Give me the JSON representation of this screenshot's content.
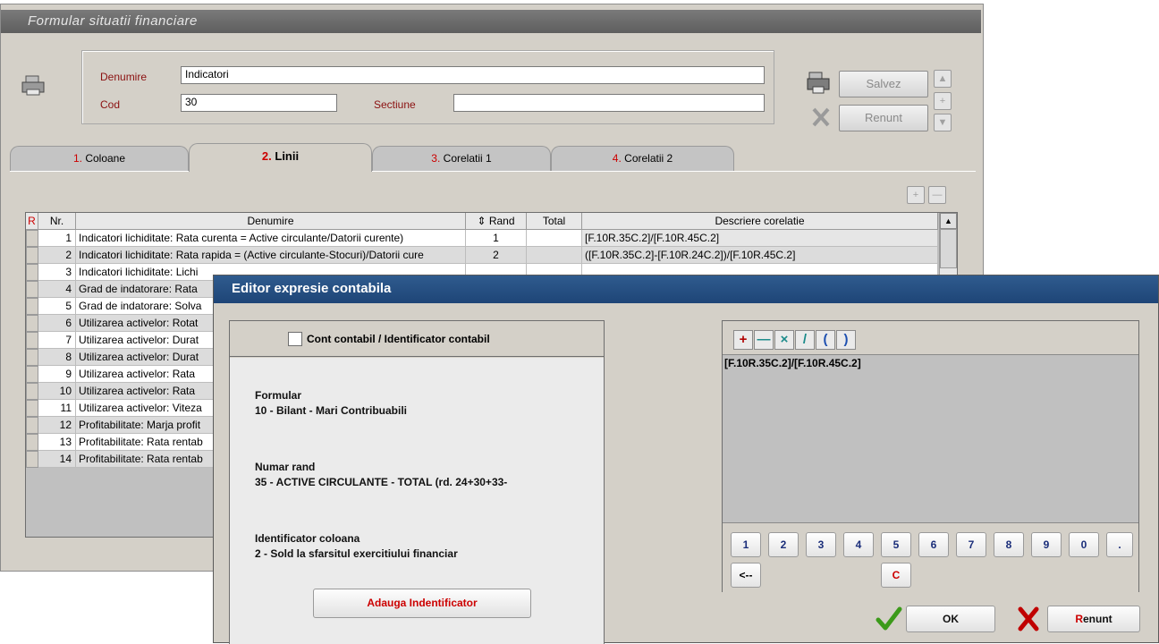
{
  "form": {
    "title": "Formular situatii financiare",
    "denumire_label": "Denumire",
    "denumire_value": "Indicatori",
    "cod_label": "Cod",
    "cod_value": "30",
    "sectiune_label": "Sectiune",
    "sectiune_value": "",
    "save_label": "Salvez",
    "cancel_label": "Renunt",
    "tabs": [
      {
        "num": "1.",
        "label": "Coloane"
      },
      {
        "num": "2.",
        "label": "Linii"
      },
      {
        "num": "3.",
        "label": "Corelatii 1"
      },
      {
        "num": "4.",
        "label": "Corelatii 2"
      }
    ],
    "grid": {
      "headers": {
        "r": "R",
        "nr": "Nr.",
        "denumire": "Denumire",
        "rand": "⇕ Rand",
        "total": "Total",
        "descriere": "Descriere corelatie"
      },
      "rows": [
        {
          "nr": "1",
          "den": "Indicatori lichiditate: Rata curenta = Active circulante/Datorii curente)",
          "rand": "1",
          "total": "",
          "desc": "[F.10R.35C.2]/[F.10R.45C.2]"
        },
        {
          "nr": "2",
          "den": "Indicatori lichiditate: Rata rapida = (Active circulante-Stocuri)/Datorii cure",
          "rand": "2",
          "total": "",
          "desc": "([F.10R.35C.2]-[F.10R.24C.2])/[F.10R.45C.2]"
        },
        {
          "nr": "3",
          "den": "Indicatori lichiditate: Lichi",
          "rand": "",
          "total": "",
          "desc": ""
        },
        {
          "nr": "4",
          "den": "Grad de indatorare: Rata",
          "rand": "",
          "total": "",
          "desc": ""
        },
        {
          "nr": "5",
          "den": "Grad de indatorare: Solva",
          "rand": "",
          "total": "",
          "desc": ""
        },
        {
          "nr": "6",
          "den": "Utilizarea activelor: Rotat",
          "rand": "",
          "total": "",
          "desc": ""
        },
        {
          "nr": "7",
          "den": "Utilizarea activelor: Durat",
          "rand": "",
          "total": "",
          "desc": ""
        },
        {
          "nr": "8",
          "den": "Utilizarea activelor: Durat",
          "rand": "",
          "total": "",
          "desc": ""
        },
        {
          "nr": "9",
          "den": "Utilizarea activelor: Rata",
          "rand": "",
          "total": "",
          "desc": ""
        },
        {
          "nr": "10",
          "den": "Utilizarea activelor: Rata",
          "rand": "",
          "total": "",
          "desc": ""
        },
        {
          "nr": "11",
          "den": "Utilizarea activelor: Viteza",
          "rand": "",
          "total": "",
          "desc": ""
        },
        {
          "nr": "12",
          "den": "Profitabilitate: Marja profit",
          "rand": "",
          "total": "",
          "desc": ""
        },
        {
          "nr": "13",
          "den": "Profitabilitate: Rata rentab",
          "rand": "",
          "total": "",
          "desc": ""
        },
        {
          "nr": "14",
          "den": "Profitabilitate: Rata rentab",
          "rand": "",
          "total": "",
          "desc": ""
        }
      ]
    }
  },
  "editor": {
    "title": "Editor expresie contabila",
    "checkbox_label": "Cont contabil / Identificator contabil",
    "formular_label": "Formular",
    "formular_value": "10 - Bilant - Mari Contribuabili",
    "numar_rand_label": "Numar rand",
    "numar_rand_value": "35 - ACTIVE CIRCULANTE - TOTAL (rd. 24+30+33-",
    "identificator_label": "Identificator coloana",
    "identificator_value": "2 - Sold la sfarsitul exercitiului financiar",
    "add_button": "Adauga Indentificator",
    "expression": "[F.10R.35C.2]/[F.10R.45C.2]",
    "operators": [
      "+",
      "—",
      "×",
      "/",
      "(",
      ")"
    ],
    "keys": [
      "1",
      "2",
      "3",
      "4",
      "5",
      "6",
      "7",
      "8",
      "9",
      "0",
      "."
    ],
    "backspace": "<--",
    "clear": "C",
    "ok_label": "OK",
    "cancel_label": "Renunt",
    "colors": {
      "title_bar": "#1e4577",
      "accent_red": "#cc0000",
      "ok_green": "#3c9a1a"
    }
  }
}
